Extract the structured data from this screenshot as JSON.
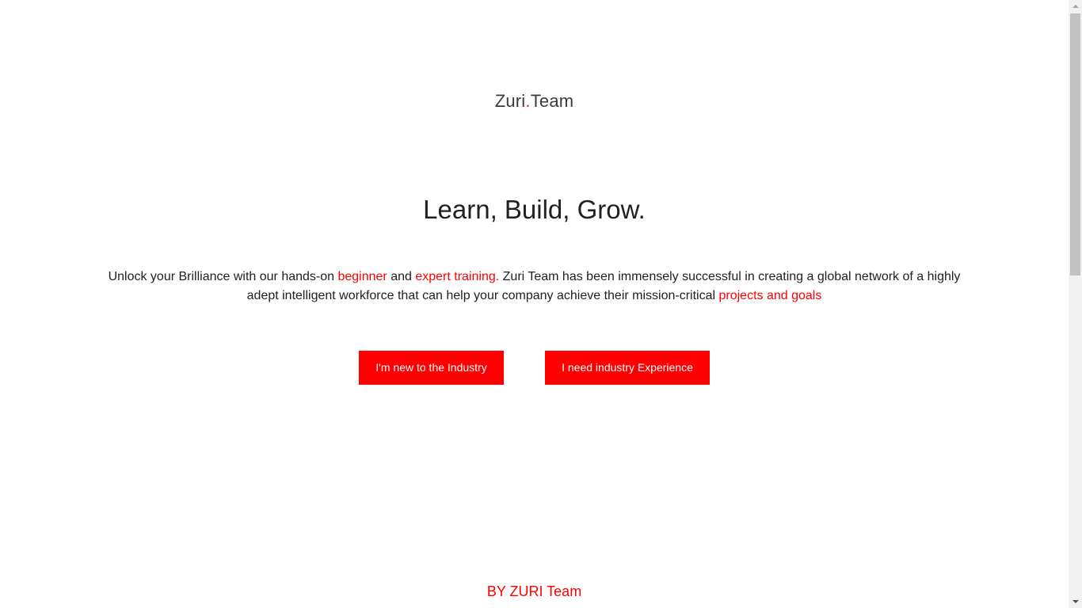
{
  "brand": {
    "logo_part1": "Zuri",
    "logo_dot": ".",
    "logo_part2": "Team",
    "accent_color": "#ff0000"
  },
  "hero": {
    "headline": "Learn, Build, Grow.",
    "intro": {
      "t1": "Unlock your Brilliance with our hands-on ",
      "link_beginner": "beginner",
      "t2": " and ",
      "link_expert": "expert training.",
      "t3": " Zuri Team has been immensely successful in creating a global network of a highly adept intelligent workforce that can help your company achieve their mission-critical ",
      "link_projects": "projects and goals"
    }
  },
  "actions": {
    "new_label": "I'm new to the Industry",
    "experience_label": "I need industry Experience"
  },
  "footer": {
    "text": "BY ZURI Team"
  }
}
